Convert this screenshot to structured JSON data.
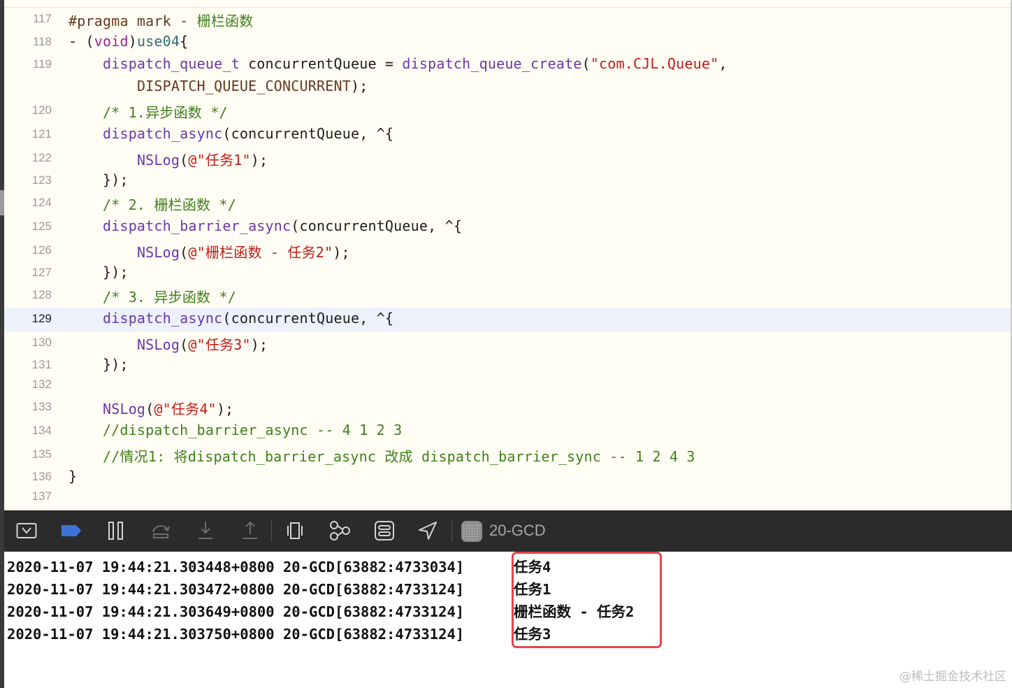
{
  "editor": {
    "lines": [
      {
        "num": "117",
        "tokens": [
          {
            "t": "#pragma mark - ",
            "c": "pre"
          },
          {
            "t": "栅栏函数",
            "c": "cm"
          }
        ]
      },
      {
        "num": "118",
        "tokens": [
          {
            "t": "- (",
            "c": "pl"
          },
          {
            "t": "void",
            "c": "kw"
          },
          {
            "t": ")",
            "c": "pl"
          },
          {
            "t": "use04",
            "c": "id"
          },
          {
            "t": "{",
            "c": "pl"
          }
        ]
      },
      {
        "num": "119",
        "tokens": [
          {
            "t": "    ",
            "c": "pl"
          },
          {
            "t": "dispatch_queue_t",
            "c": "fn"
          },
          {
            "t": " concurrentQueue = ",
            "c": "pl"
          },
          {
            "t": "dispatch_queue_create",
            "c": "fn"
          },
          {
            "t": "(",
            "c": "pl"
          },
          {
            "t": "\"com.CJL.Queue\"",
            "c": "str"
          },
          {
            "t": ",",
            "c": "pl"
          }
        ]
      },
      {
        "num": "",
        "tokens": [
          {
            "t": "        ",
            "c": "pl"
          },
          {
            "t": "DISPATCH_QUEUE_CONCURRENT",
            "c": "pre"
          },
          {
            "t": ");",
            "c": "pl"
          }
        ]
      },
      {
        "num": "120",
        "tokens": [
          {
            "t": "    ",
            "c": "pl"
          },
          {
            "t": "/* 1.异步函数 */",
            "c": "cm"
          }
        ]
      },
      {
        "num": "121",
        "tokens": [
          {
            "t": "    ",
            "c": "pl"
          },
          {
            "t": "dispatch_async",
            "c": "fn"
          },
          {
            "t": "(concurrentQueue, ^{",
            "c": "pl"
          }
        ]
      },
      {
        "num": "122",
        "tokens": [
          {
            "t": "        ",
            "c": "pl"
          },
          {
            "t": "NSLog",
            "c": "fn"
          },
          {
            "t": "(",
            "c": "pl"
          },
          {
            "t": "@\"任务1\"",
            "c": "str"
          },
          {
            "t": ");",
            "c": "pl"
          }
        ]
      },
      {
        "num": "123",
        "tokens": [
          {
            "t": "    });",
            "c": "pl"
          }
        ]
      },
      {
        "num": "124",
        "tokens": [
          {
            "t": "    ",
            "c": "pl"
          },
          {
            "t": "/* 2. 栅栏函数 */",
            "c": "cm"
          }
        ]
      },
      {
        "num": "125",
        "tokens": [
          {
            "t": "    ",
            "c": "pl"
          },
          {
            "t": "dispatch_barrier_async",
            "c": "fn"
          },
          {
            "t": "(concurrentQueue, ^{",
            "c": "pl"
          }
        ]
      },
      {
        "num": "126",
        "tokens": [
          {
            "t": "        ",
            "c": "pl"
          },
          {
            "t": "NSLog",
            "c": "fn"
          },
          {
            "t": "(",
            "c": "pl"
          },
          {
            "t": "@\"栅栏函数 - 任务2\"",
            "c": "str"
          },
          {
            "t": ");",
            "c": "pl"
          }
        ]
      },
      {
        "num": "127",
        "tokens": [
          {
            "t": "    });",
            "c": "pl"
          }
        ]
      },
      {
        "num": "128",
        "tokens": [
          {
            "t": "    ",
            "c": "pl"
          },
          {
            "t": "/* 3. 异步函数 */",
            "c": "cm"
          }
        ]
      },
      {
        "num": "129",
        "current": true,
        "tokens": [
          {
            "t": "    ",
            "c": "pl"
          },
          {
            "t": "dispatch_async",
            "c": "fn"
          },
          {
            "t": "(concurrentQueue, ^{",
            "c": "pl"
          }
        ]
      },
      {
        "num": "130",
        "tokens": [
          {
            "t": "        ",
            "c": "pl"
          },
          {
            "t": "NSLog",
            "c": "fn"
          },
          {
            "t": "(",
            "c": "pl"
          },
          {
            "t": "@\"任务3\"",
            "c": "str"
          },
          {
            "t": ");",
            "c": "pl"
          }
        ]
      },
      {
        "num": "131",
        "tokens": [
          {
            "t": "    });",
            "c": "pl"
          }
        ]
      },
      {
        "num": "132",
        "tokens": []
      },
      {
        "num": "133",
        "tokens": [
          {
            "t": "    ",
            "c": "pl"
          },
          {
            "t": "NSLog",
            "c": "fn"
          },
          {
            "t": "(",
            "c": "pl"
          },
          {
            "t": "@\"任务4\"",
            "c": "str"
          },
          {
            "t": ");",
            "c": "pl"
          }
        ]
      },
      {
        "num": "134",
        "tokens": [
          {
            "t": "    ",
            "c": "pl"
          },
          {
            "t": "//dispatch_barrier_async -- 4 1 2 3",
            "c": "cm"
          }
        ]
      },
      {
        "num": "135",
        "tokens": [
          {
            "t": "    ",
            "c": "pl"
          },
          {
            "t": "//情况1: 将dispatch_barrier_async 改成 dispatch_barrier_sync -- 1 2 4 3",
            "c": "cm"
          }
        ]
      },
      {
        "num": "136",
        "tokens": [
          {
            "t": "}",
            "c": "pl"
          }
        ]
      },
      {
        "num": "137",
        "tokens": []
      }
    ]
  },
  "toolbar": {
    "buttons": [
      {
        "name": "hide-debug-area-button",
        "icon": "hide-panel-icon"
      },
      {
        "name": "breakpoints-toggle-button",
        "icon": "breakpoint-icon"
      },
      {
        "name": "pause-button",
        "icon": "pause-icon"
      },
      {
        "name": "step-over-button",
        "icon": "step-over-icon"
      },
      {
        "name": "step-into-button",
        "icon": "step-into-icon"
      },
      {
        "name": "step-out-button",
        "icon": "step-out-icon"
      },
      {
        "name": "view-hierarchy-button",
        "icon": "view-debugger-icon"
      },
      {
        "name": "memory-graph-button",
        "icon": "memory-graph-icon"
      },
      {
        "name": "environment-overrides-button",
        "icon": "environment-overrides-icon"
      },
      {
        "name": "simulate-location-button",
        "icon": "location-arrow-icon"
      }
    ],
    "scheme": {
      "icon": "app-scheme-icon",
      "label": "20-GCD"
    }
  },
  "console": {
    "lines": [
      {
        "prefix": "2020-11-07 19:44:21.303448+0800 20-GCD[63882:4733034]",
        "message": "任务4"
      },
      {
        "prefix": "2020-11-07 19:44:21.303472+0800 20-GCD[63882:4733124]",
        "message": "任务1"
      },
      {
        "prefix": "2020-11-07 19:44:21.303649+0800 20-GCD[63882:4733124]",
        "message": "栅栏函数 - 任务2"
      },
      {
        "prefix": "2020-11-07 19:44:21.303750+0800 20-GCD[63882:4733124]",
        "message": "任务3"
      }
    ],
    "highlight_color": "#e0454e"
  },
  "watermark": "@稀土掘金技术社区",
  "colors": {
    "editor_bg": "#fffdf4",
    "current_line_bg": "#ecf1fa",
    "keyword": "#9b2393",
    "function": "#6c36a9",
    "string": "#c41a16",
    "comment": "#3f7f1b",
    "toolbar_bg": "#2b2b2b"
  }
}
